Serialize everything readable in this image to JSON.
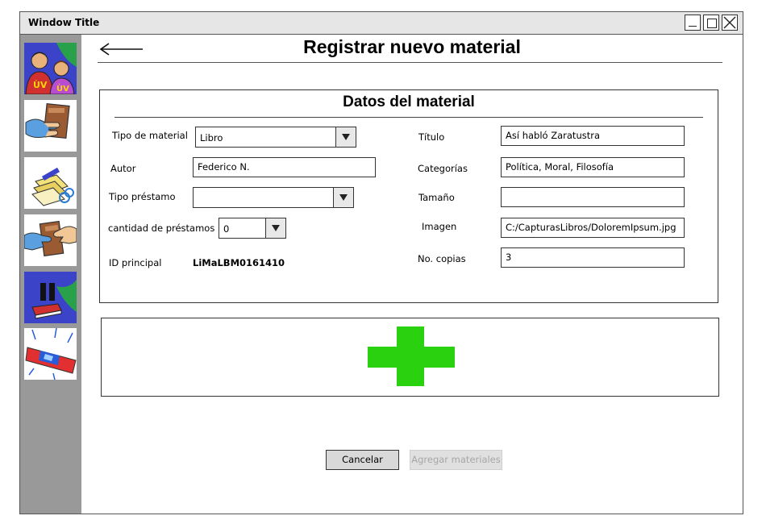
{
  "window": {
    "title": "Window Title"
  },
  "sidebar": {
    "items": [
      {
        "icon": "users-icon"
      },
      {
        "icon": "hand-book-icon"
      },
      {
        "icon": "library-cards-icon"
      },
      {
        "icon": "book-exchange-icon"
      },
      {
        "icon": "pause-book-icon"
      },
      {
        "icon": "siren-alert-icon"
      }
    ]
  },
  "header": {
    "back_icon": "back-arrow-icon",
    "title": "Registrar nuevo material"
  },
  "form": {
    "title": "Datos del material",
    "tipo_material": {
      "label": "Tipo de material",
      "value": "Libro"
    },
    "autor": {
      "label": "Autor",
      "value": "Federico N."
    },
    "tipo_prestamo": {
      "label": "Tipo préstamo",
      "value": ""
    },
    "cantidad_prestamos": {
      "label": "cantidad de préstamos",
      "value": "0"
    },
    "id_principal": {
      "label": "ID principal",
      "value": "LiMaLBM0161410"
    },
    "titulo": {
      "label": "Título",
      "value": "Así habló Zaratustra"
    },
    "categorias": {
      "label": "Categorías",
      "value": "Política, Moral, Filosofía"
    },
    "tamano": {
      "label": "Tamaño",
      "value": ""
    },
    "imagen": {
      "label": "Imagen",
      "value": "C:/CapturasLibros/DoloremIpsum.jpg"
    },
    "copias": {
      "label": "No. copias",
      "value": "3"
    }
  },
  "add_section": {
    "icon": "plus-icon",
    "color": "#2ad10f"
  },
  "actions": {
    "cancel_label": "Cancelar",
    "add_label": "Agregar materiales"
  }
}
